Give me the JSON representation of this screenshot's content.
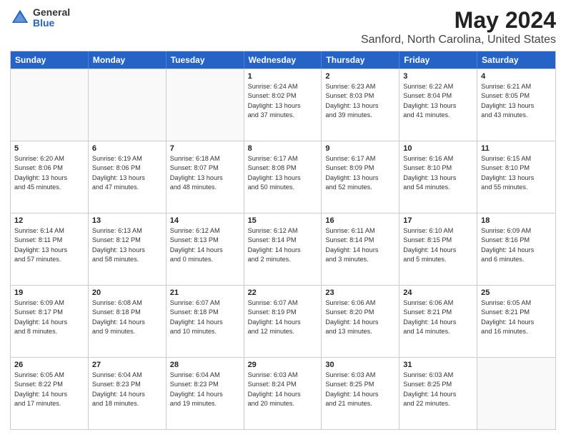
{
  "logo": {
    "general": "General",
    "blue": "Blue"
  },
  "header": {
    "title": "May 2024",
    "subtitle": "Sanford, North Carolina, United States"
  },
  "weekdays": [
    "Sunday",
    "Monday",
    "Tuesday",
    "Wednesday",
    "Thursday",
    "Friday",
    "Saturday"
  ],
  "weeks": [
    [
      {
        "day": "",
        "info": ""
      },
      {
        "day": "",
        "info": ""
      },
      {
        "day": "",
        "info": ""
      },
      {
        "day": "1",
        "info": "Sunrise: 6:24 AM\nSunset: 8:02 PM\nDaylight: 13 hours\nand 37 minutes."
      },
      {
        "day": "2",
        "info": "Sunrise: 6:23 AM\nSunset: 8:03 PM\nDaylight: 13 hours\nand 39 minutes."
      },
      {
        "day": "3",
        "info": "Sunrise: 6:22 AM\nSunset: 8:04 PM\nDaylight: 13 hours\nand 41 minutes."
      },
      {
        "day": "4",
        "info": "Sunrise: 6:21 AM\nSunset: 8:05 PM\nDaylight: 13 hours\nand 43 minutes."
      }
    ],
    [
      {
        "day": "5",
        "info": "Sunrise: 6:20 AM\nSunset: 8:06 PM\nDaylight: 13 hours\nand 45 minutes."
      },
      {
        "day": "6",
        "info": "Sunrise: 6:19 AM\nSunset: 8:06 PM\nDaylight: 13 hours\nand 47 minutes."
      },
      {
        "day": "7",
        "info": "Sunrise: 6:18 AM\nSunset: 8:07 PM\nDaylight: 13 hours\nand 48 minutes."
      },
      {
        "day": "8",
        "info": "Sunrise: 6:17 AM\nSunset: 8:08 PM\nDaylight: 13 hours\nand 50 minutes."
      },
      {
        "day": "9",
        "info": "Sunrise: 6:17 AM\nSunset: 8:09 PM\nDaylight: 13 hours\nand 52 minutes."
      },
      {
        "day": "10",
        "info": "Sunrise: 6:16 AM\nSunset: 8:10 PM\nDaylight: 13 hours\nand 54 minutes."
      },
      {
        "day": "11",
        "info": "Sunrise: 6:15 AM\nSunset: 8:10 PM\nDaylight: 13 hours\nand 55 minutes."
      }
    ],
    [
      {
        "day": "12",
        "info": "Sunrise: 6:14 AM\nSunset: 8:11 PM\nDaylight: 13 hours\nand 57 minutes."
      },
      {
        "day": "13",
        "info": "Sunrise: 6:13 AM\nSunset: 8:12 PM\nDaylight: 13 hours\nand 58 minutes."
      },
      {
        "day": "14",
        "info": "Sunrise: 6:12 AM\nSunset: 8:13 PM\nDaylight: 14 hours\nand 0 minutes."
      },
      {
        "day": "15",
        "info": "Sunrise: 6:12 AM\nSunset: 8:14 PM\nDaylight: 14 hours\nand 2 minutes."
      },
      {
        "day": "16",
        "info": "Sunrise: 6:11 AM\nSunset: 8:14 PM\nDaylight: 14 hours\nand 3 minutes."
      },
      {
        "day": "17",
        "info": "Sunrise: 6:10 AM\nSunset: 8:15 PM\nDaylight: 14 hours\nand 5 minutes."
      },
      {
        "day": "18",
        "info": "Sunrise: 6:09 AM\nSunset: 8:16 PM\nDaylight: 14 hours\nand 6 minutes."
      }
    ],
    [
      {
        "day": "19",
        "info": "Sunrise: 6:09 AM\nSunset: 8:17 PM\nDaylight: 14 hours\nand 8 minutes."
      },
      {
        "day": "20",
        "info": "Sunrise: 6:08 AM\nSunset: 8:18 PM\nDaylight: 14 hours\nand 9 minutes."
      },
      {
        "day": "21",
        "info": "Sunrise: 6:07 AM\nSunset: 8:18 PM\nDaylight: 14 hours\nand 10 minutes."
      },
      {
        "day": "22",
        "info": "Sunrise: 6:07 AM\nSunset: 8:19 PM\nDaylight: 14 hours\nand 12 minutes."
      },
      {
        "day": "23",
        "info": "Sunrise: 6:06 AM\nSunset: 8:20 PM\nDaylight: 14 hours\nand 13 minutes."
      },
      {
        "day": "24",
        "info": "Sunrise: 6:06 AM\nSunset: 8:21 PM\nDaylight: 14 hours\nand 14 minutes."
      },
      {
        "day": "25",
        "info": "Sunrise: 6:05 AM\nSunset: 8:21 PM\nDaylight: 14 hours\nand 16 minutes."
      }
    ],
    [
      {
        "day": "26",
        "info": "Sunrise: 6:05 AM\nSunset: 8:22 PM\nDaylight: 14 hours\nand 17 minutes."
      },
      {
        "day": "27",
        "info": "Sunrise: 6:04 AM\nSunset: 8:23 PM\nDaylight: 14 hours\nand 18 minutes."
      },
      {
        "day": "28",
        "info": "Sunrise: 6:04 AM\nSunset: 8:23 PM\nDaylight: 14 hours\nand 19 minutes."
      },
      {
        "day": "29",
        "info": "Sunrise: 6:03 AM\nSunset: 8:24 PM\nDaylight: 14 hours\nand 20 minutes."
      },
      {
        "day": "30",
        "info": "Sunrise: 6:03 AM\nSunset: 8:25 PM\nDaylight: 14 hours\nand 21 minutes."
      },
      {
        "day": "31",
        "info": "Sunrise: 6:03 AM\nSunset: 8:25 PM\nDaylight: 14 hours\nand 22 minutes."
      },
      {
        "day": "",
        "info": ""
      }
    ]
  ]
}
